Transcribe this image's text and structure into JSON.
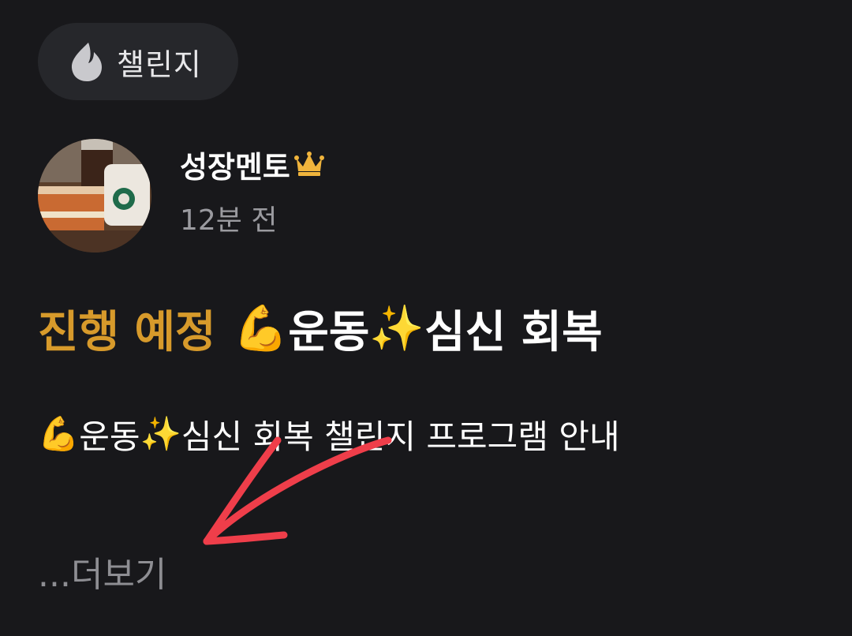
{
  "challenge_chip": {
    "icon": "flame-icon",
    "label": "챌린지"
  },
  "post": {
    "author": {
      "name": "성장멘토",
      "badge_icon": "crown-icon",
      "avatar": "coffee-and-cake-photo"
    },
    "time_ago": "12분 전",
    "title": {
      "status": "진행 예정",
      "emoji_1": "💪",
      "text_1": "운동",
      "emoji_2": "✨",
      "text_2": "심신 회복"
    },
    "body": {
      "emoji_1": "💪",
      "text_1": "운동",
      "emoji_2": "✨",
      "text_2": "심신 회복 챌린지 프로그램 안내"
    },
    "more_label": "...더보기"
  },
  "colors": {
    "background": "#18181b",
    "chip_background": "#26272b",
    "status_orange": "#d79a2b",
    "muted_text": "#9a9a9f",
    "annotation_arrow": "#ef3e4a"
  },
  "annotation": {
    "arrow_icon": "red-arrow-annotation"
  }
}
